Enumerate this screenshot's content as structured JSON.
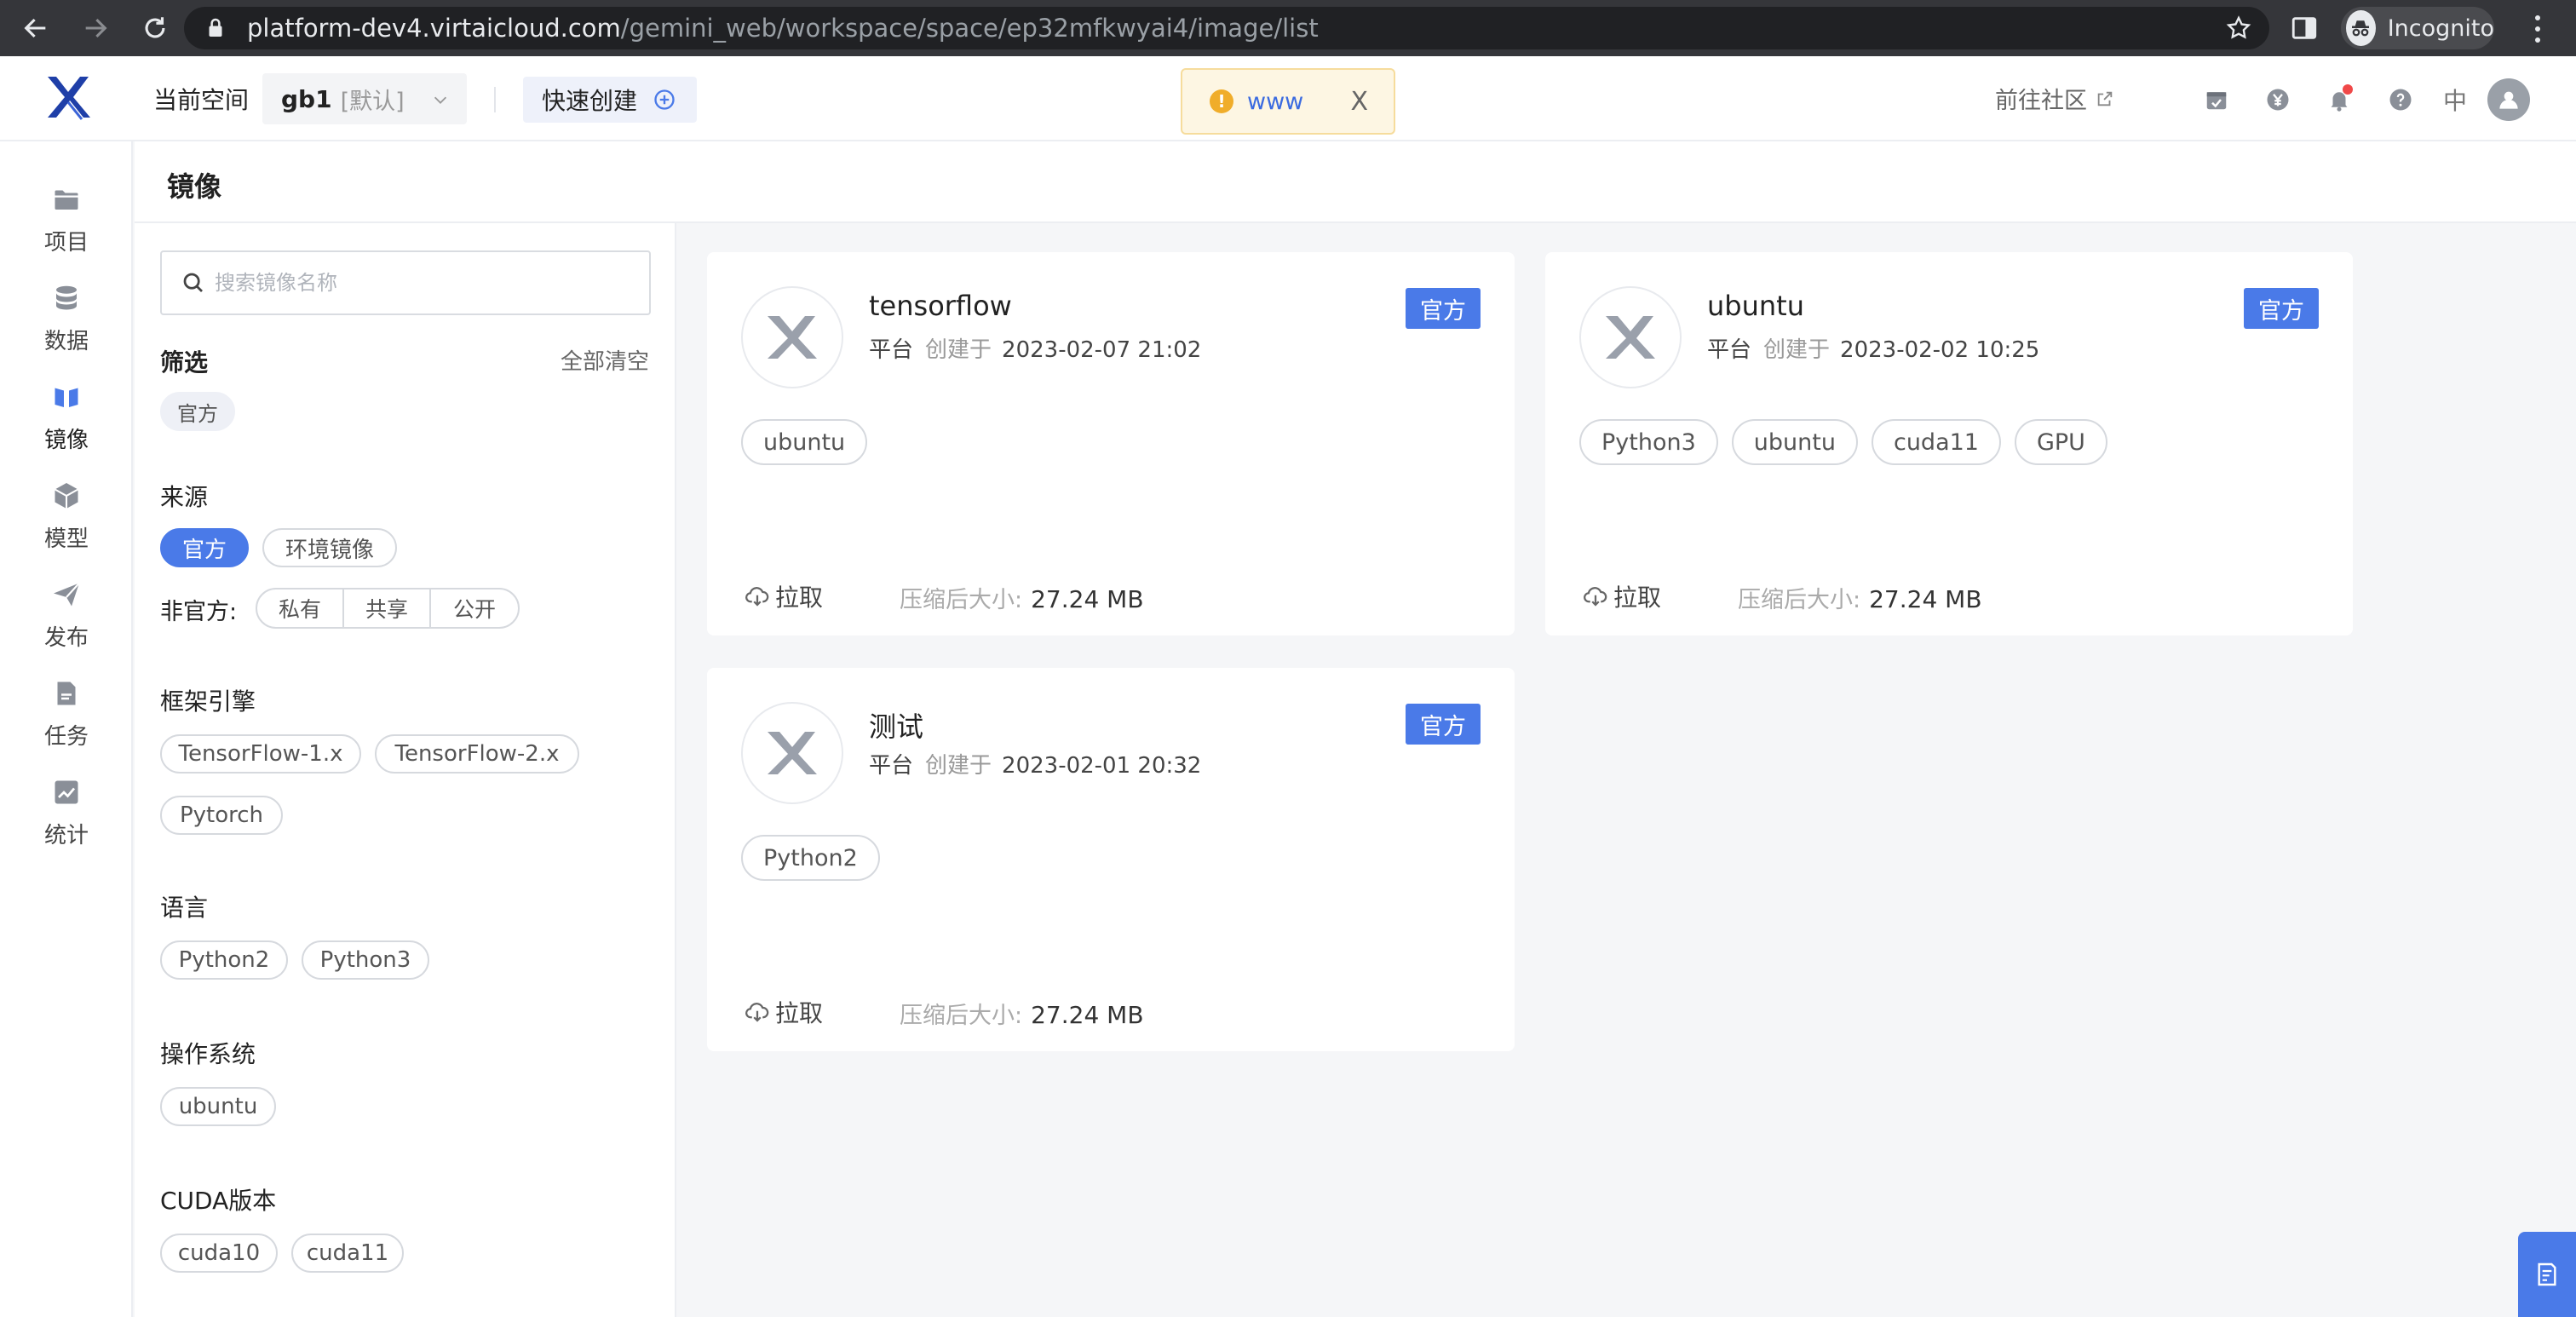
{
  "browser": {
    "url_host": "platform-dev4.virtaicloud.com",
    "url_path": "/gemini_web/workspace/space/ep32mfkwyai4/image/list",
    "incognito_label": "Incognito"
  },
  "header": {
    "space_label": "当前空间",
    "space_name": "gb1",
    "space_default": "[默认]",
    "quick_create": "快速创建",
    "toast_message": "www",
    "toast_close": "X",
    "community": "前往社区",
    "lang": "中"
  },
  "nav": [
    {
      "label": "项目",
      "icon": "folder-icon"
    },
    {
      "label": "数据",
      "icon": "database-icon"
    },
    {
      "label": "镜像",
      "icon": "image-icon",
      "active": true
    },
    {
      "label": "模型",
      "icon": "cube-icon"
    },
    {
      "label": "发布",
      "icon": "send-icon"
    },
    {
      "label": "任务",
      "icon": "task-icon"
    },
    {
      "label": "统计",
      "icon": "chart-icon"
    }
  ],
  "page_title": "镜像",
  "filter": {
    "search_placeholder": "搜索镜像名称",
    "filter_title": "筛选",
    "clear_all": "全部清空",
    "selected_tag": "官方",
    "source_title": "来源",
    "source_official": "官方",
    "source_env": "环境镜像",
    "unofficial_label": "非官方:",
    "unofficial_options": [
      "私有",
      "共享",
      "公开"
    ],
    "framework_title": "框架引擎",
    "frameworks": [
      "TensorFlow-1.x",
      "TensorFlow-2.x",
      "Pytorch"
    ],
    "language_title": "语言",
    "languages": [
      "Python2",
      "Python3"
    ],
    "os_title": "操作系统",
    "os": [
      "ubuntu"
    ],
    "cuda_title": "CUDA版本",
    "cuda": [
      "cuda10",
      "cuda11"
    ]
  },
  "cards": [
    {
      "name": "tensorflow",
      "owner": "平台",
      "created_label": "创建于",
      "created": "2023-02-07 21:02",
      "badge": "官方",
      "tags": [
        "ubuntu"
      ],
      "pull": "拉取",
      "size_label": "压缩后大小:",
      "size": "27.24 MB"
    },
    {
      "name": "ubuntu",
      "owner": "平台",
      "created_label": "创建于",
      "created": "2023-02-02 10:25",
      "badge": "官方",
      "tags": [
        "Python3",
        "ubuntu",
        "cuda11",
        "GPU"
      ],
      "pull": "拉取",
      "size_label": "压缩后大小:",
      "size": "27.24 MB"
    },
    {
      "name": "测试",
      "owner": "平台",
      "created_label": "创建于",
      "created": "2023-02-01 20:32",
      "badge": "官方",
      "tags": [
        "Python2"
      ],
      "pull": "拉取",
      "size_label": "压缩后大小:",
      "size": "27.24 MB"
    }
  ],
  "colors": {
    "accent": "#4a7ae8",
    "warning": "#f0ad2a"
  }
}
